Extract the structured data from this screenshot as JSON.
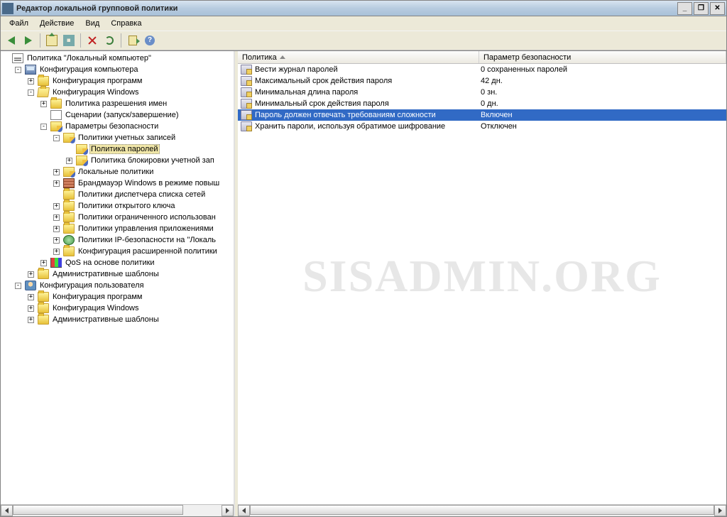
{
  "window": {
    "title": "Редактор локальной групповой политики"
  },
  "menu": {
    "file": "Файл",
    "action": "Действие",
    "view": "Вид",
    "help": "Справка"
  },
  "tree": {
    "root": "Политика \"Локальный компьютер\"",
    "computer_config": "Конфигурация компьютера",
    "software_settings": "Конфигурация программ",
    "windows_settings": "Конфигурация Windows",
    "name_resolution": "Политика разрешения имен",
    "scripts": "Сценарии (запуск/завершение)",
    "security_settings": "Параметры безопасности",
    "account_policies": "Политики учетных записей",
    "password_policy": "Политика паролей",
    "lockout_policy": "Политика блокировки учетной зап",
    "local_policies": "Локальные политики",
    "firewall": "Брандмауэр Windows в режиме повыш",
    "network_list": "Политики диспетчера списка сетей",
    "public_key": "Политики открытого ключа",
    "software_restriction": "Политики ограниченного использован",
    "app_control": "Политики управления приложениями",
    "ip_security": "Политики IP-безопасности на \"Локаль",
    "advanced_audit": "Конфигурация расширенной политики",
    "qos": "QoS на основе политики",
    "admin_templates_c": "Административные шаблоны",
    "user_config": "Конфигурация пользователя",
    "software_settings_u": "Конфигурация программ",
    "windows_settings_u": "Конфигурация Windows",
    "admin_templates_u": "Административные шаблоны"
  },
  "list": {
    "col_policy": "Политика",
    "col_setting": "Параметр безопасности",
    "rows": [
      {
        "policy": "Вести журнал паролей",
        "value": "0 сохраненных паролей"
      },
      {
        "policy": "Максимальный срок действия пароля",
        "value": "42 дн."
      },
      {
        "policy": "Минимальная длина пароля",
        "value": "0 зн."
      },
      {
        "policy": "Минимальный срок действия пароля",
        "value": "0 дн."
      },
      {
        "policy": "Пароль должен отвечать требованиям сложности",
        "value": "Включен"
      },
      {
        "policy": "Хранить пароли, используя обратимое шифрование",
        "value": "Отключен"
      }
    ],
    "selected_index": 4
  },
  "watermark": "SISADMIN.ORG",
  "help_glyph": "?"
}
